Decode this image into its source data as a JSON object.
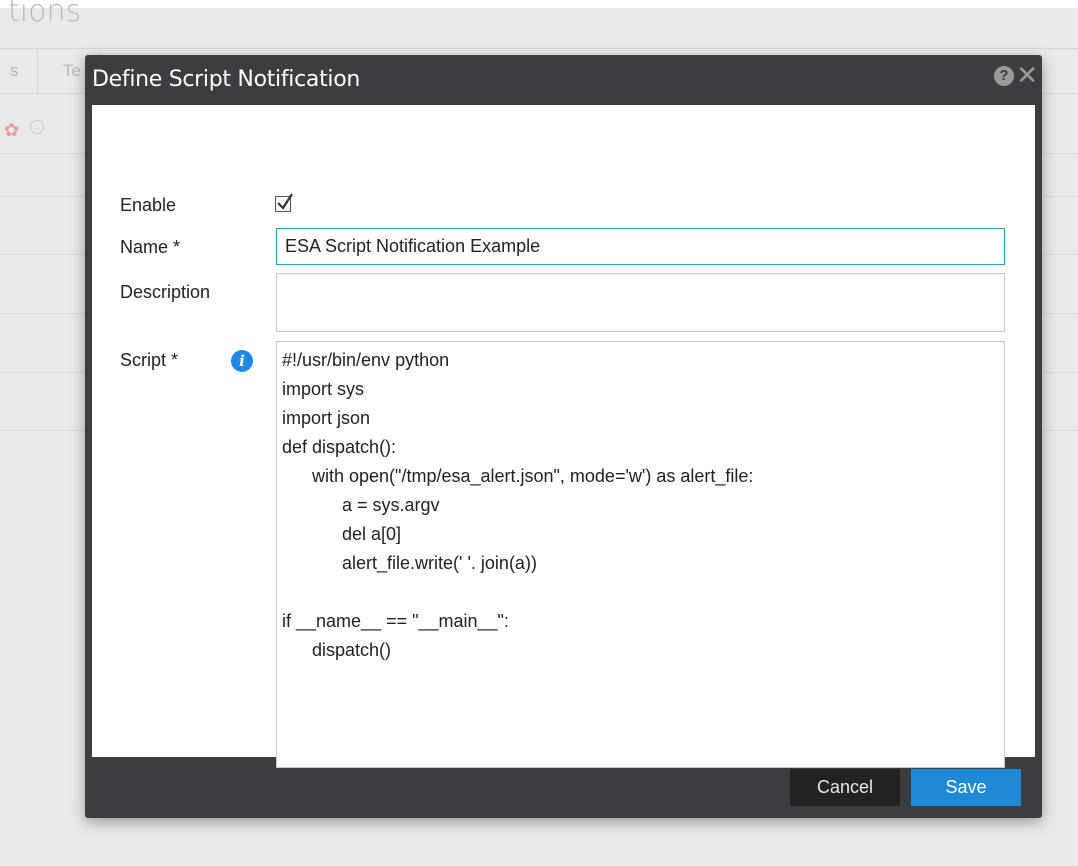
{
  "background": {
    "page_title": "tions",
    "tabs": [
      "s",
      "Te"
    ]
  },
  "modal": {
    "title": "Define Script Notification",
    "help_icon": "question-circle-icon",
    "close_icon": "close-icon",
    "fields": {
      "enable_label": "Enable",
      "enable_checked": true,
      "name_label": "Name *",
      "name_value": "ESA Script Notification Example",
      "description_label": "Description",
      "description_value": "",
      "script_label": "Script *",
      "script_value": "#!/usr/bin/env python\nimport sys\nimport json\ndef dispatch():\n      with open(\"/tmp/esa_alert.json\", mode='w') as alert_file:\n            a = sys.argv\n            del a[0]\n            alert_file.write(' '. join(a))\n\nif __name__ == \"__main__\":\n      dispatch()"
    },
    "buttons": {
      "cancel": "Cancel",
      "save": "Save"
    },
    "colors": {
      "header_bg": "#3b3d40",
      "save_bg": "#1e8ad6",
      "cancel_bg": "#222325",
      "focus_border": "#2aa0c4",
      "info_icon": "#1e88e5"
    }
  }
}
